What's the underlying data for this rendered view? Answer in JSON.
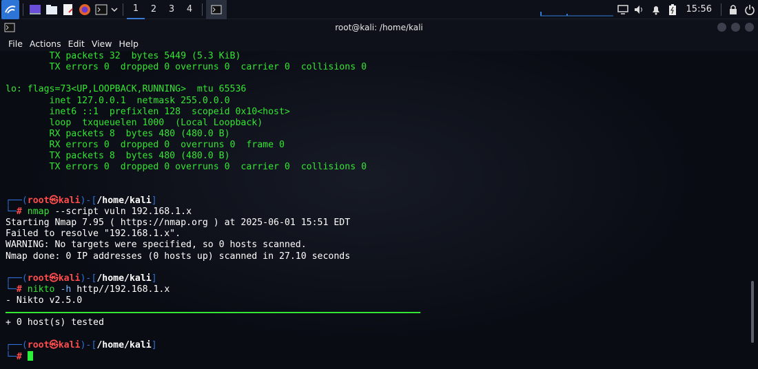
{
  "panel": {
    "workspaces": [
      "1",
      "2",
      "3",
      "4"
    ],
    "active_workspace": "1",
    "clock": "15:56",
    "icons": [
      "kali-menu-icon",
      "desktop-icon",
      "file-manager-icon",
      "text-editor-icon",
      "firefox-icon",
      "terminal-icon",
      "chevron-down-icon",
      "monitor-icon",
      "volume-icon",
      "notification-bell-icon",
      "battery-icon",
      "lock-icon",
      "power-icon"
    ]
  },
  "window": {
    "title": "root@kali: /home/kali",
    "menu": [
      "File",
      "Actions",
      "Edit",
      "View",
      "Help"
    ]
  },
  "terminal": {
    "out1": [
      "        TX packets 32  bytes 5449 (5.3 KiB)",
      "        TX errors 0  dropped 0 overruns 0  carrier 0  collisions 0"
    ],
    "lo_header": "lo: flags=73<UP,LOOPBACK,RUNNING>  mtu 65536",
    "lo_lines": [
      "        inet 127.0.0.1  netmask 255.0.0.0",
      "        inet6 ::1  prefixlen 128  scopeid 0x10<host>",
      "        loop  txqueuelen 1000  (Local Loopback)",
      "        RX packets 8  bytes 480 (480.0 B)",
      "        RX errors 0  dropped 0  overruns 0  frame 0",
      "        TX packets 8  bytes 480 (480.0 B)",
      "        TX errors 0  dropped 0 overruns 0  carrier 0  collisions 0"
    ],
    "prompt": {
      "top_left": "┌──(",
      "user": "root㉿kali",
      "mid": ")-[",
      "path": "/home/kali",
      "end": "]",
      "bottom_left": "└─",
      "hash": "#"
    },
    "cmd1": {
      "name": "nmap",
      "args": "--script vuln 192.168.1.x"
    },
    "nmap_out": [
      "Starting Nmap 7.95 ( https://nmap.org ) at 2025-06-01 15:51 EDT",
      "Failed to resolve \"192.168.1.x\".",
      "WARNING: No targets were specified, so 0 hosts scanned.",
      "Nmap done: 0 IP addresses (0 hosts up) scanned in 27.10 seconds"
    ],
    "cmd2": {
      "name": "nikto",
      "args": "-h",
      "args2": "http//192.168.1.x"
    },
    "nikto_out1": "- Nikto v2.5.0",
    "nikto_out2": "+ 0 host(s) tested"
  }
}
